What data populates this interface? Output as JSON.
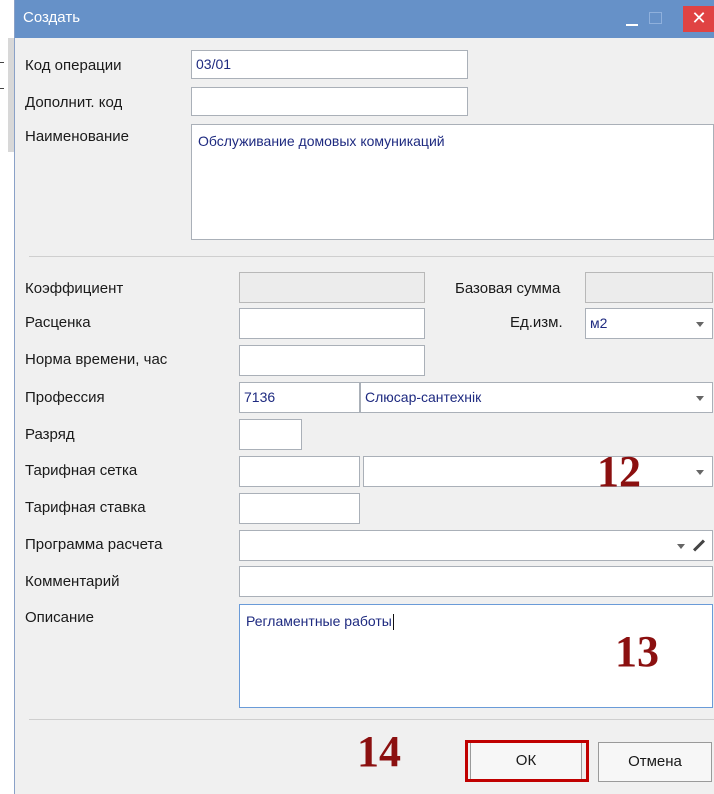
{
  "window": {
    "title": "Создать"
  },
  "form": {
    "code_label": "Код операции",
    "code_value": "03/01",
    "addcode_label": "Дополнит. код",
    "addcode_value": "",
    "name_label": "Наименование",
    "name_value": "Обслуживание домовых комуникаций",
    "coef_label": "Коэффициент",
    "base_label": "Базовая сумма",
    "rate_label": "Расценка",
    "unit_label": "Ед.изм.",
    "unit_value": "м2",
    "time_label": "Норма времени, час",
    "prof_label": "Профессия",
    "prof_code": "7136",
    "prof_name": "Слюсар-сантехнік",
    "grade_label": "Разряд",
    "grid_label": "Тарифная сетка",
    "tariff_label": "Тарифная ставка",
    "program_label": "Программа расчета",
    "comment_label": "Комментарий",
    "desc_label": "Описание",
    "desc_value": "Регламентные работы"
  },
  "buttons": {
    "ok": "ОК",
    "cancel": "Отмена"
  },
  "annotations": {
    "a12": "12",
    "a13": "13",
    "a14": "14"
  },
  "colors": {
    "titlebar": "#6691c8",
    "close": "#e04343",
    "annotation": "#8b1010",
    "highlight": "#c00000"
  }
}
